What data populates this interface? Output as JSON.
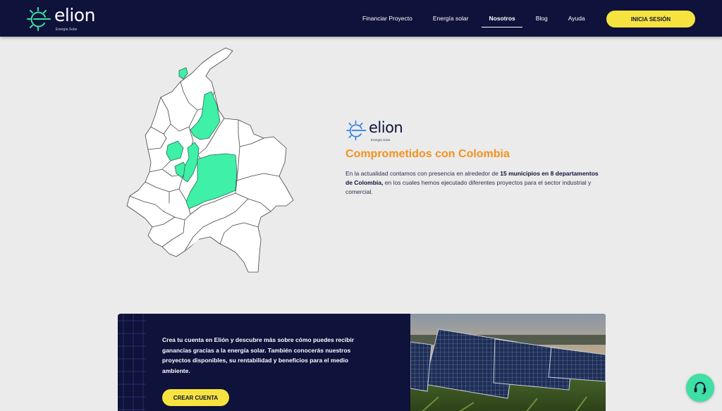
{
  "nav": {
    "brand": "elion",
    "brand_sub": "Energía Solar",
    "links": [
      {
        "label": "Financiar Proyecto"
      },
      {
        "label": "Energía solar"
      },
      {
        "label": "Nosotros",
        "active": true
      },
      {
        "label": "Blog"
      },
      {
        "label": "Ayuda"
      }
    ],
    "login_label": "INICIA SESIÓN"
  },
  "info": {
    "brand": "elion",
    "brand_sub": "Energía Solar",
    "title": "Comprometidos con Colombia",
    "text_pre": "En la actualidad contamos con presencia en alrededor de ",
    "text_bold": "15 municipios en 8 departamentos de Colombia,",
    "text_post": " en los cuales hemos ejecutado diferentes proyectos para el sector industrial y comercial."
  },
  "cta": {
    "text": "Crea tu cuenta en Elión y descubre más sobre cómo puedes recibir ganancias gracias a la energía solar. También conocerás nuestros proyectos disponibles, su rentabilidad y beneficios para el medio ambiente.",
    "button_label": "CREAR CUENTA"
  },
  "icons": {
    "logo": "sun-e-logo-icon",
    "help": "headset-icon"
  },
  "colors": {
    "navy": "#0f123a",
    "accent_yellow": "#f6e33f",
    "accent_green": "#3ee0a4",
    "title_orange": "#f39220",
    "logo_blue": "#2f7fe6"
  }
}
